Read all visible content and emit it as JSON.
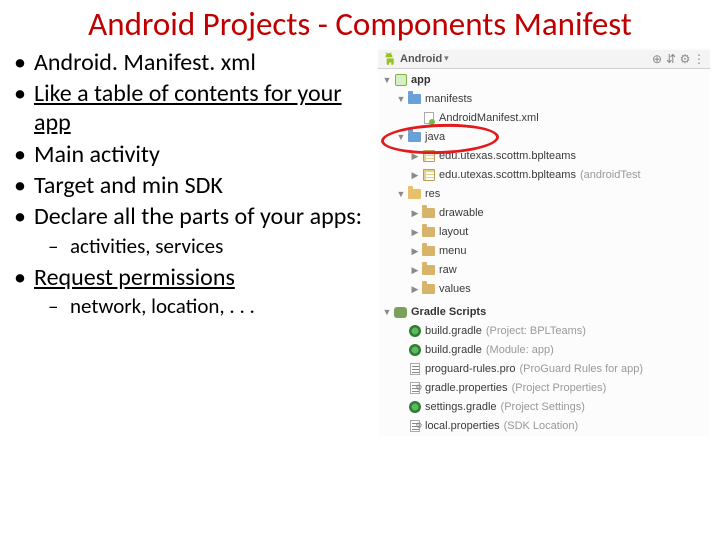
{
  "title": "Android Projects - Components Manifest",
  "bullets": {
    "b0": "Android. Manifest. xml",
    "b1": "Like a table of contents for your app",
    "b2": "Main activity",
    "b3": "Target and min SDK",
    "b4": "Declare all the parts of your apps:",
    "b4_sub": "activities, services",
    "b5": "Request permissions",
    "b5_sub": "network, location, . . ."
  },
  "panel": {
    "dropdown_label": "Android",
    "tools": {
      "target": "⊕",
      "collapse": "⇵",
      "gear": "⚙",
      "menu": "⋮"
    }
  },
  "tree": {
    "app": "app",
    "manifests": "manifests",
    "manifest_file": "AndroidManifest.xml",
    "java": "java",
    "pkg1": "edu.utexas.scottm.bplteams",
    "pkg2": "edu.utexas.scottm.bplteams",
    "pkg2_note": "(androidTest",
    "res": "res",
    "drawable": "drawable",
    "layout": "layout",
    "menu": "menu",
    "raw": "raw",
    "values": "values",
    "gradle_scripts": "Gradle Scripts",
    "bg1": "build.gradle",
    "bg1_note": "(Project: BPLTeams)",
    "bg2": "build.gradle",
    "bg2_note": "(Module: app)",
    "proguard": "proguard-rules.pro",
    "proguard_note": "(ProGuard Rules for app)",
    "gp1": "gradle.properties",
    "gp1_note": "(Project Properties)",
    "settings": "settings.gradle",
    "settings_note": "(Project Settings)",
    "lp": "local.properties",
    "lp_note": "(SDK Location)"
  }
}
